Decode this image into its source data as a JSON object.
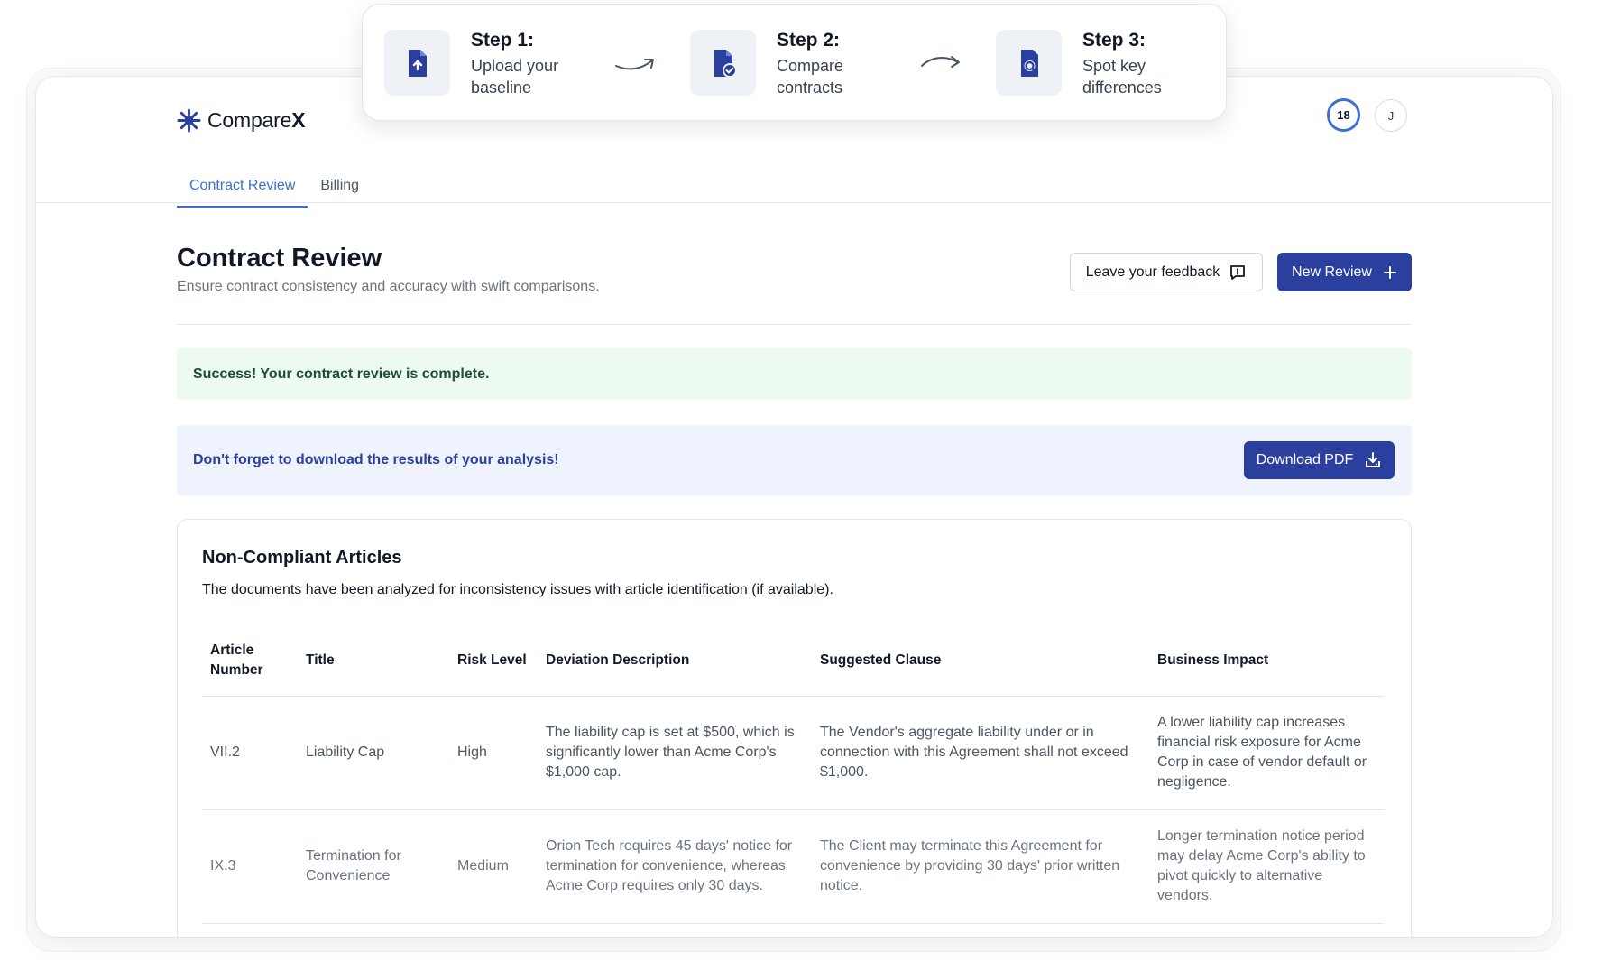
{
  "steps": [
    {
      "heading": "Step 1:",
      "line1": "Upload your",
      "line2": "baseline"
    },
    {
      "heading": "Step 2:",
      "line1": "Compare",
      "line2": "contracts"
    },
    {
      "heading": "Step 3:",
      "line1": "Spot key",
      "line2": "differences"
    }
  ],
  "header": {
    "brand_regular": "Compare",
    "brand_bold": "X",
    "credits": "18",
    "avatar_initial": "J"
  },
  "tabs": [
    {
      "label": "Contract Review",
      "active": true
    },
    {
      "label": "Billing",
      "active": false
    }
  ],
  "page": {
    "title": "Contract Review",
    "subtitle": "Ensure contract consistency and accuracy with swift comparisons.",
    "feedback_label": "Leave your feedback",
    "new_review_label": "New Review"
  },
  "alerts": {
    "success": "Success! Your contract review is complete.",
    "info": "Don't forget to download the results of your analysis!",
    "download_label": "Download PDF"
  },
  "card": {
    "title": "Non-Compliant Articles",
    "subtitle": "The documents have been analyzed for inconsistency issues with article identification (if available).",
    "columns": [
      "Article Number",
      "Title",
      "Risk Level",
      "Deviation Description",
      "Suggested Clause",
      "Business Impact"
    ],
    "rows": [
      {
        "article": "VII.2",
        "title": "Liability Cap",
        "risk": "High",
        "deviation": "The liability cap is set at $500, which is significantly lower than Acme Corp's $1,000 cap.",
        "suggested": "The Vendor's aggregate liability under or in connection with this Agreement shall not exceed $1,000.",
        "impact": "A lower liability cap increases financial risk exposure for Acme Corp in case of vendor default or negligence."
      },
      {
        "article": "IX.3",
        "title": "Termination for Convenience",
        "risk": "Medium",
        "deviation": "Orion Tech requires 45 days' notice for termination for convenience, whereas Acme Corp requires only 30 days.",
        "suggested": "The Client may terminate this Agreement for convenience by providing 30 days' prior written notice.",
        "impact": "Longer termination notice period may delay Acme Corp's ability to pivot quickly to alternative vendors."
      }
    ]
  },
  "colors": {
    "primary": "#2b3f9e",
    "accent": "#3b6fd4",
    "success_bg": "#ecfaf2",
    "info_bg": "#eef3fd"
  }
}
